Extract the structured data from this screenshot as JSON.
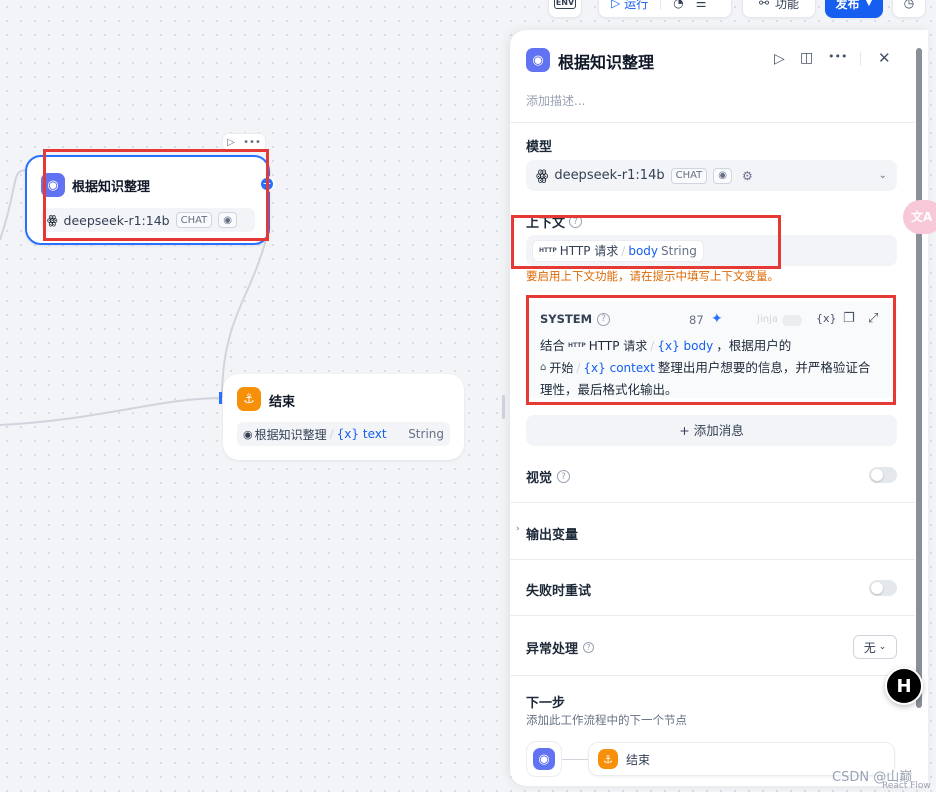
{
  "topbar": {
    "env_label": "ENV",
    "run_label": "运行",
    "features_label": "功能",
    "publish_label": "发布"
  },
  "canvas": {
    "llm_node": {
      "title": "根据知识整理",
      "model": "deepseek-r1:14b",
      "mode_badge": "CHAT"
    },
    "end_node": {
      "title": "结束",
      "var_source": "根据知识整理",
      "var_name": "{x} text",
      "var_type": "String"
    }
  },
  "panel": {
    "title": "根据知识整理",
    "description_placeholder": "添加描述...",
    "model_section": {
      "label": "模型",
      "model_name": "deepseek-r1:14b",
      "mode_badge": "CHAT"
    },
    "context_section": {
      "label": "上下文",
      "source_badge": "HTTP",
      "source_node": "HTTP 请求",
      "variable": "body",
      "variable_type": "String",
      "warning": "要启用上下文功能，请在提示中填写上下文变量。"
    },
    "system_prompt": {
      "label": "SYSTEM",
      "token_count": "87",
      "jinja_label": "Jinja",
      "line1_prefix": "结合",
      "http_badge": "HTTP",
      "ref1_node": "HTTP 请求",
      "ref1_var": "{x} body",
      "line1_suffix": "，根据用户的",
      "ref2_node": "开始",
      "ref2_var": "{x} context",
      "line2_suffix": "整理出用户想要的信息，并严格验证合",
      "line3": "理性，最后格式化输出。"
    },
    "add_message_label": "+ 添加消息",
    "vision_label": "视觉",
    "output_vars_label": "输出变量",
    "retry_label": "失败时重试",
    "error_handling": {
      "label": "异常处理",
      "value": "无"
    },
    "next_step": {
      "title": "下一步",
      "subtitle": "添加此工作流程中的下一个节点",
      "next_node": "结束"
    }
  },
  "overlays": {
    "translate_badge": "文A",
    "watermark": "CSDN @山巅",
    "reactflow": "React Flow"
  },
  "colors": {
    "primary": "#155eef",
    "node_blue": "#6172f3",
    "node_orange": "#f79009",
    "warning_text": "#dc6803",
    "highlight_box": "#e53935"
  }
}
